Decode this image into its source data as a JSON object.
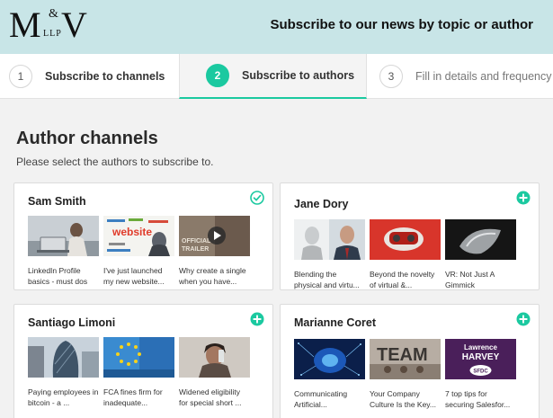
{
  "header": {
    "logo_m": "M",
    "logo_amp": "&",
    "logo_v": "V",
    "logo_llp": "LLP",
    "title": "Subscribe to our news by topic or author"
  },
  "steps": [
    {
      "number": "1",
      "label": "Subscribe to channels"
    },
    {
      "number": "2",
      "label": "Subscribe to authors"
    },
    {
      "number": "3",
      "label": "Fill in details and frequency"
    }
  ],
  "page": {
    "title": "Author channels",
    "subtitle": "Please select the authors to subscribe to."
  },
  "authors": [
    {
      "name": "Sam Smith",
      "action_icon": "check-circle-icon",
      "articles": [
        {
          "caption": "LinkedIn Profile basics - must dos"
        },
        {
          "caption": "I've just launched my new website..."
        },
        {
          "caption": "Why create a single when you have..."
        }
      ]
    },
    {
      "name": "Jane Dory",
      "action_icon": "plus-circle-icon",
      "articles": [
        {
          "caption": "Blending the physical and virtu..."
        },
        {
          "caption": "Beyond the novelty of virtual &..."
        },
        {
          "caption": "VR: Not Just A Gimmick"
        }
      ]
    },
    {
      "name": "Santiago Limoni",
      "action_icon": "plus-circle-icon",
      "articles": [
        {
          "caption": "Paying employees in bitcoin - a ..."
        },
        {
          "caption": "FCA fines firm for inadequate..."
        },
        {
          "caption": "Widened eligibility for special short ..."
        }
      ]
    },
    {
      "name": "Marianne Coret",
      "action_icon": "plus-circle-icon",
      "articles": [
        {
          "caption": "Communicating Artificial..."
        },
        {
          "caption": "Your Company Culture Is the Key..."
        },
        {
          "caption": "7 top tips for securing Salesfor..."
        }
      ]
    }
  ],
  "thumb_text": {
    "website_word": "website",
    "official": "OFFICIAL",
    "trailer": "TRAILER",
    "team_word": "TEAM",
    "harvey_line1": "Lawrence",
    "harvey_line2": "HARVEY",
    "sfdc": "SFDC"
  },
  "colors": {
    "accent": "#1bc9a0",
    "header_bg": "#c8e5e7",
    "page_bg": "#f2f2f2"
  }
}
